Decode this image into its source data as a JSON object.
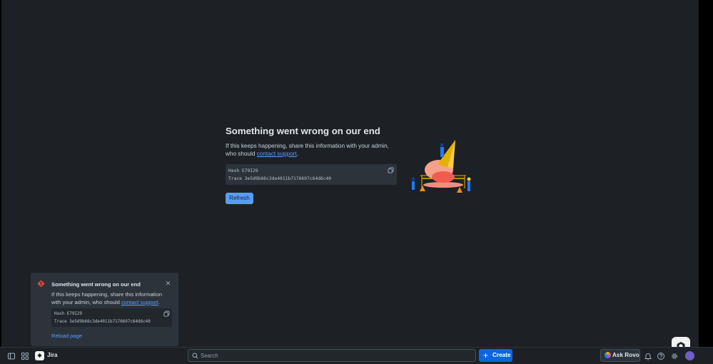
{
  "main_error": {
    "title": "Something went wrong on our end",
    "text_before": "If this keeps happening, share this information with your admin, who should ",
    "link": "contact support",
    "text_after": ".",
    "hash_line": "Hash E79I29",
    "trace_line": "Trace 3e5d9b66c3de4011b7176697c64d6c40",
    "refresh_label": "Refresh"
  },
  "toast": {
    "title": "Something went wrong on our end",
    "text_before": "If this keeps happening, share this information with your admin, who should ",
    "link": "contact support",
    "text_after": ".",
    "hash_line": "Hash E79I29",
    "trace_line": "Trace 3e5d9b66c3de4011b7176697c64d6c40",
    "reload_label": "Reload page"
  },
  "bottom_nav": {
    "app_name": "Jira",
    "search_placeholder": "Search",
    "create_label": "Create",
    "rovo_label": "Ask Rovo",
    "icons": [
      "sidebar-toggle-icon",
      "app-switcher-icon",
      "jira-logo",
      "search-icon",
      "bell-icon",
      "help-icon",
      "settings-icon",
      "avatar"
    ]
  },
  "colors": {
    "background": "#1d2125",
    "link": "#579dff",
    "primary_button": "#0c66e4",
    "error_icon": "#e2483d"
  }
}
